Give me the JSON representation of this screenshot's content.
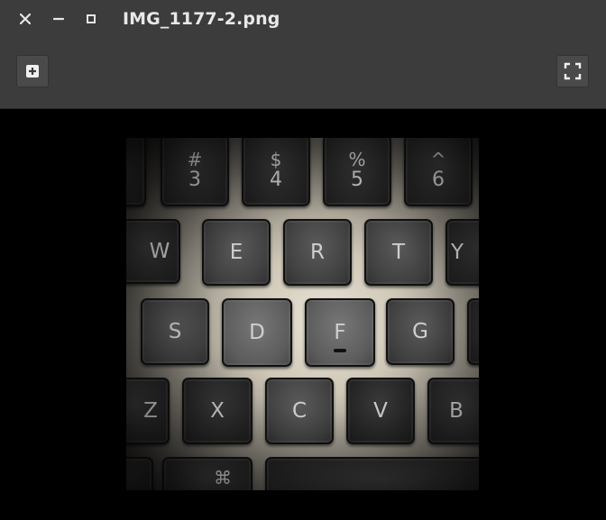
{
  "window": {
    "title": "IMG_1177-2.png"
  },
  "titlebar_buttons": [
    {
      "name": "close-icon",
      "glyph": "×"
    },
    {
      "name": "minimize-icon",
      "glyph": "–"
    },
    {
      "name": "maximize-icon",
      "glyph": "□"
    }
  ],
  "toolbar": {
    "add_icon": "plus-icon",
    "fullscreen_icon": "fullscreen-icon"
  },
  "photo": {
    "row1": [
      {
        "top": "#",
        "bottom": "3"
      },
      {
        "top": "$",
        "bottom": "4"
      },
      {
        "top": "%",
        "bottom": "5"
      },
      {
        "top": "^",
        "bottom": "6"
      }
    ],
    "row2": [
      "W",
      "E",
      "R",
      "T",
      "Y"
    ],
    "row3": [
      "S",
      "D",
      "F",
      "G"
    ],
    "row4": [
      "Z",
      "X",
      "C",
      "V",
      "B"
    ],
    "row5": [
      "⌘"
    ]
  },
  "colors": {
    "chrome": "#3c3c3c",
    "viewer_bg": "#000000",
    "title_text": "#e8e8e8"
  }
}
